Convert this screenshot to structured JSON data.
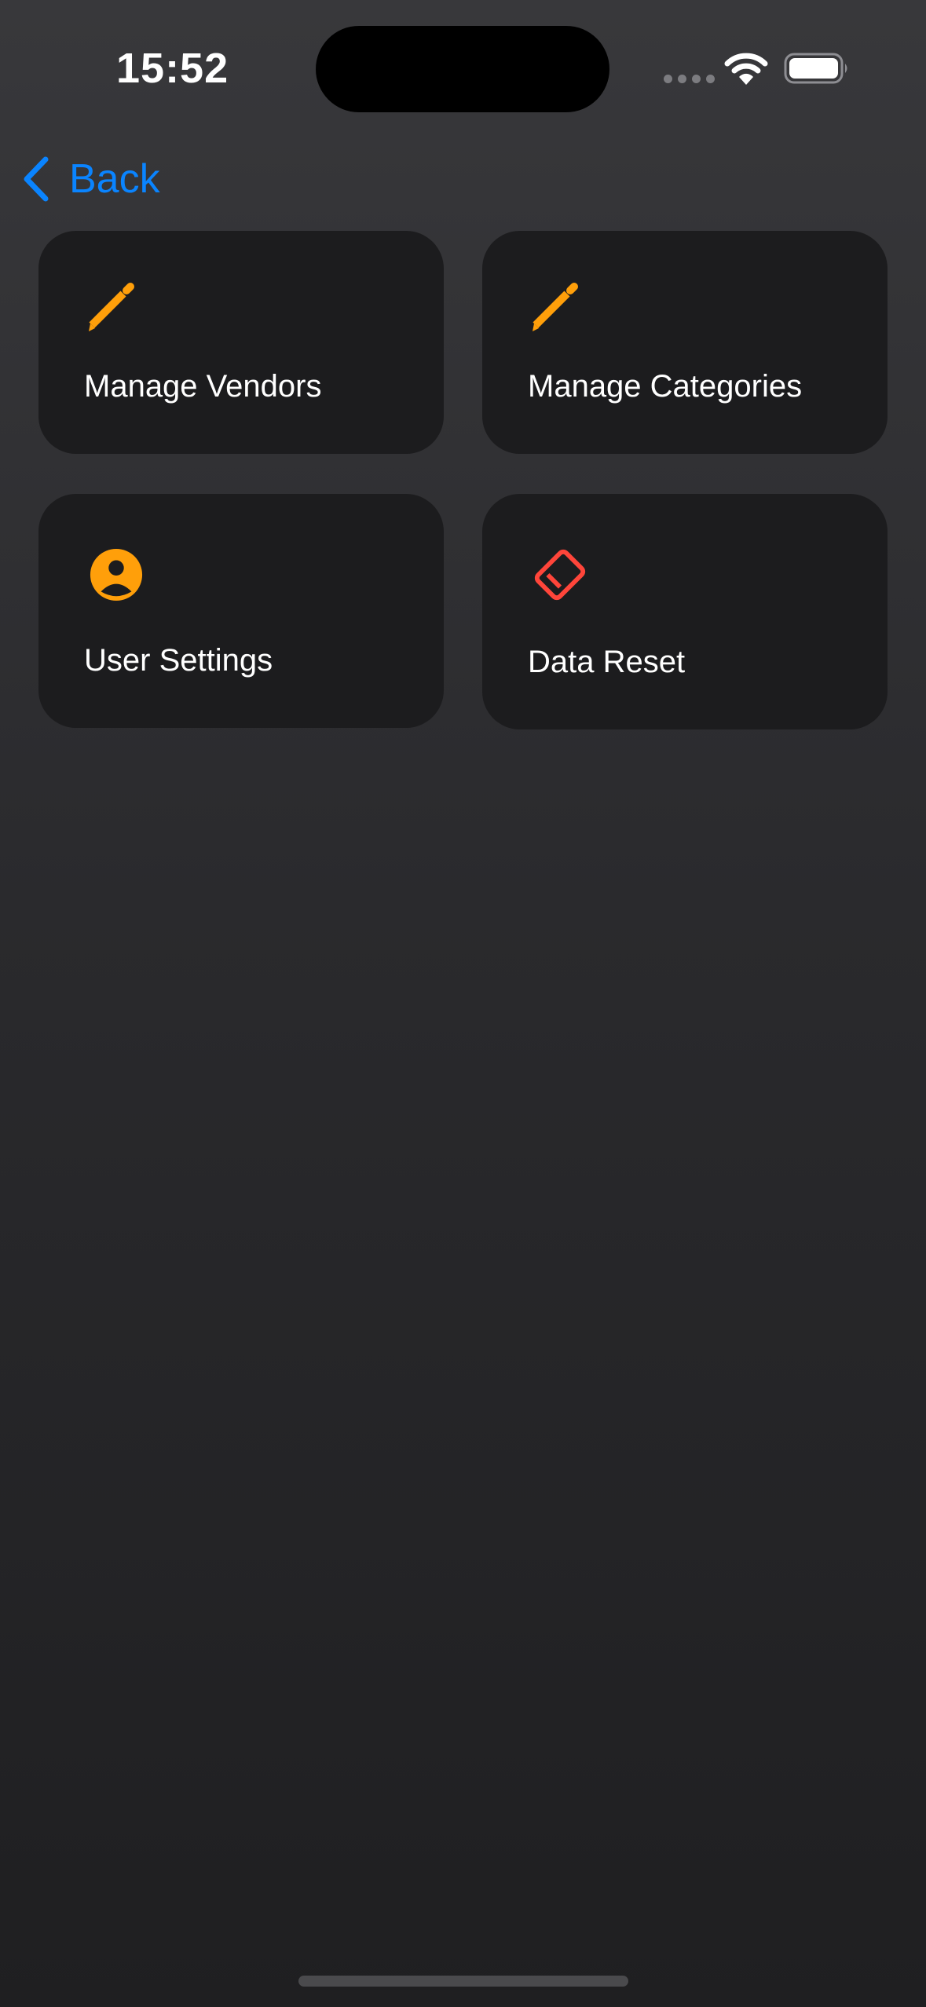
{
  "status_bar": {
    "time": "15:52",
    "icons": [
      "signal-dots-icon",
      "wifi-icon",
      "battery-icon"
    ]
  },
  "nav": {
    "back_label": "Back",
    "back_icon": "chevron-left-icon"
  },
  "tiles": [
    {
      "label": "Manage Vendors",
      "icon": "pencil-icon",
      "icon_color": "#ff9f0a"
    },
    {
      "label": "Manage Categories",
      "icon": "pencil-icon",
      "icon_color": "#ff9f0a"
    },
    {
      "label": "User Settings",
      "icon": "person-circle-icon",
      "icon_color": "#ff9f0a"
    },
    {
      "label": "Data Reset",
      "icon": "eraser-icon",
      "icon_color": "#ff453a"
    }
  ],
  "colors": {
    "accent": "#0a84ff",
    "tile_background": "#1c1c1e",
    "orange": "#ff9f0a",
    "red": "#ff453a"
  }
}
